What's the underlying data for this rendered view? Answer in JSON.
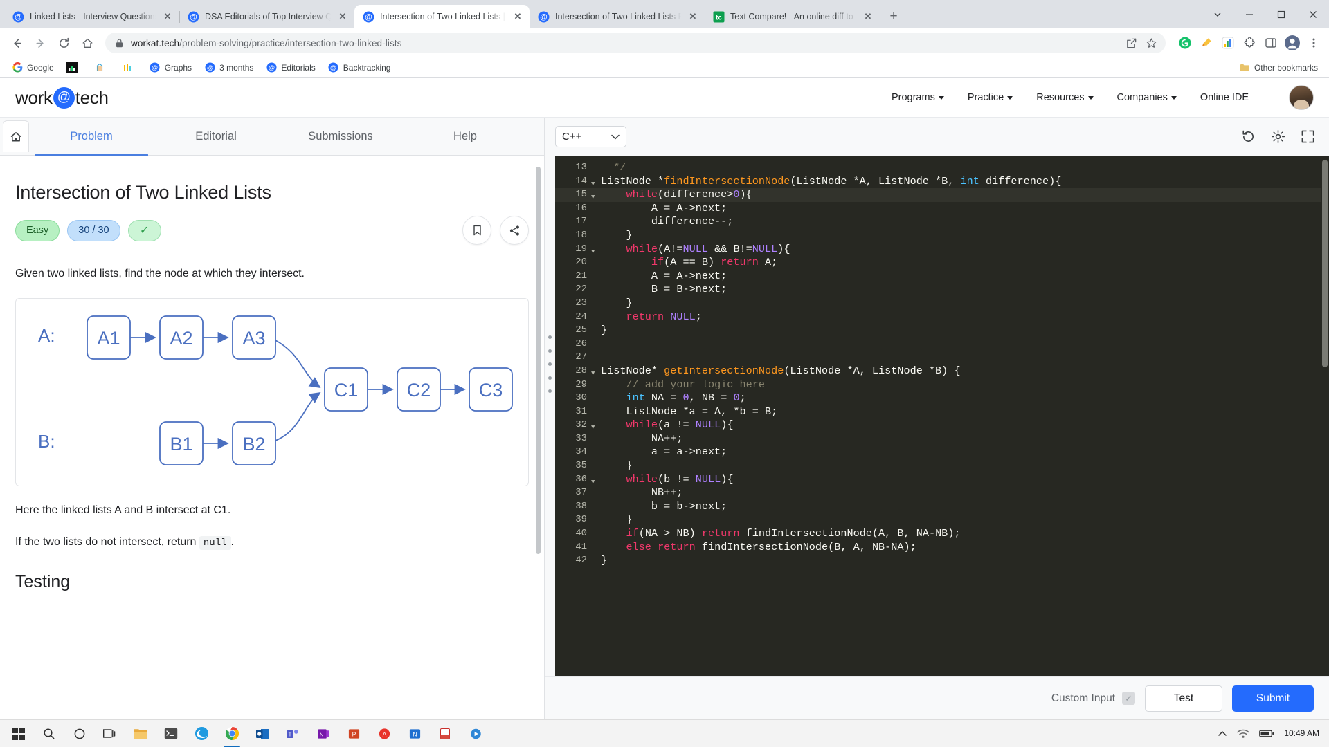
{
  "browser": {
    "tabs": [
      {
        "title": "Linked Lists - Interview Questions",
        "favicon": "workattech-icon",
        "active": false
      },
      {
        "title": "DSA Editorials of Top Interview Q",
        "favicon": "workattech-icon",
        "active": false
      },
      {
        "title": "Intersection of Two Linked Lists |",
        "favicon": "workattech-icon",
        "active": true
      },
      {
        "title": "Intersection of Two Linked Lists E",
        "favicon": "workattech-icon",
        "active": false
      },
      {
        "title": "Text Compare! - An online diff to",
        "favicon": "textcompare-icon",
        "active": false
      }
    ],
    "new_tab_label": "+",
    "url_bold": "workat.tech",
    "url_dim": "/problem-solving/practice/intersection-two-linked-lists",
    "window_controls": {
      "minimize": "–",
      "maximize": "❐",
      "close": "✕"
    },
    "bookmarks": [
      {
        "label": "Google",
        "icon": "google-icon"
      },
      {
        "label": "",
        "icon": "dark-chart-icon"
      },
      {
        "label": "",
        "icon": "ladder-icon"
      },
      {
        "label": "",
        "icon": "bars-icon"
      },
      {
        "label": "Graphs",
        "icon": "workattech-icon"
      },
      {
        "label": "3 months",
        "icon": "workattech-icon"
      },
      {
        "label": "Editorials",
        "icon": "workattech-icon"
      },
      {
        "label": "Backtracking",
        "icon": "workattech-icon"
      }
    ],
    "other_bookmarks": "Other bookmarks"
  },
  "site": {
    "logo_left": "work",
    "logo_at": "@",
    "logo_right": "tech",
    "nav": [
      {
        "label": "Programs",
        "has_caret": true
      },
      {
        "label": "Practice",
        "has_caret": true
      },
      {
        "label": "Resources",
        "has_caret": true
      },
      {
        "label": "Companies",
        "has_caret": true
      },
      {
        "label": "Online IDE",
        "has_caret": false
      }
    ]
  },
  "problem": {
    "tabs": [
      {
        "label": "Problem",
        "active": true
      },
      {
        "label": "Editorial",
        "active": false
      },
      {
        "label": "Submissions",
        "active": false
      },
      {
        "label": "Help",
        "active": false
      }
    ],
    "title": "Intersection of Two Linked Lists",
    "badges": {
      "difficulty": "Easy",
      "score": "30 / 30",
      "solved_check": "✓"
    },
    "description": "Given two linked lists, find the node at which they intersect.",
    "note": "Here the linked lists A and B intersect at C1.",
    "no_intersect_prefix": "If the two lists do not intersect, return",
    "no_intersect_code": "null",
    "no_intersect_suffix": ".",
    "testing_heading": "Testing",
    "figure": {
      "label_a": "A:",
      "label_b": "B:",
      "nodes_a": [
        "A1",
        "A2",
        "A3"
      ],
      "nodes_b": [
        "B1",
        "B2"
      ],
      "nodes_c": [
        "C1",
        "C2",
        "C3"
      ]
    }
  },
  "editor": {
    "language": "C++",
    "dropdown_caret": "⌄",
    "toolbar": {
      "reset": "reset-icon",
      "settings": "gear-icon",
      "fullscreen": "expand-icon"
    },
    "first_line_number": 13,
    "highlighted_line": 15,
    "lines": [
      {
        "n": 13,
        "fold": false,
        "tokens": [
          {
            "t": "  ",
            "c": "op"
          },
          {
            "t": "*/",
            "c": "cm"
          }
        ]
      },
      {
        "n": 14,
        "fold": true,
        "tokens": [
          {
            "t": "ListNode *",
            "c": "op"
          },
          {
            "t": "findIntersectionNode",
            "c": "fn"
          },
          {
            "t": "(ListNode *A, ListNode *B, ",
            "c": "op"
          },
          {
            "t": "int",
            "c": "ty"
          },
          {
            "t": " difference){",
            "c": "op"
          }
        ]
      },
      {
        "n": 15,
        "fold": true,
        "tokens": [
          {
            "t": "    ",
            "c": "op"
          },
          {
            "t": "while",
            "c": "k"
          },
          {
            "t": "(difference>",
            "c": "op"
          },
          {
            "t": "0",
            "c": "nl"
          },
          {
            "t": "){",
            "c": "op"
          }
        ]
      },
      {
        "n": 16,
        "fold": false,
        "tokens": [
          {
            "t": "        A = A->next;",
            "c": "op"
          }
        ]
      },
      {
        "n": 17,
        "fold": false,
        "tokens": [
          {
            "t": "        difference--;",
            "c": "op"
          }
        ]
      },
      {
        "n": 18,
        "fold": false,
        "tokens": [
          {
            "t": "    }",
            "c": "op"
          }
        ]
      },
      {
        "n": 19,
        "fold": true,
        "tokens": [
          {
            "t": "    ",
            "c": "op"
          },
          {
            "t": "while",
            "c": "k"
          },
          {
            "t": "(A!=",
            "c": "op"
          },
          {
            "t": "NULL",
            "c": "nl"
          },
          {
            "t": " && B!=",
            "c": "op"
          },
          {
            "t": "NULL",
            "c": "nl"
          },
          {
            "t": "){",
            "c": "op"
          }
        ]
      },
      {
        "n": 20,
        "fold": false,
        "tokens": [
          {
            "t": "        ",
            "c": "op"
          },
          {
            "t": "if",
            "c": "k"
          },
          {
            "t": "(A == B) ",
            "c": "op"
          },
          {
            "t": "return",
            "c": "k"
          },
          {
            "t": " A;",
            "c": "op"
          }
        ]
      },
      {
        "n": 21,
        "fold": false,
        "tokens": [
          {
            "t": "        A = A->next;",
            "c": "op"
          }
        ]
      },
      {
        "n": 22,
        "fold": false,
        "tokens": [
          {
            "t": "        B = B->next;",
            "c": "op"
          }
        ]
      },
      {
        "n": 23,
        "fold": false,
        "tokens": [
          {
            "t": "    }",
            "c": "op"
          }
        ]
      },
      {
        "n": 24,
        "fold": false,
        "tokens": [
          {
            "t": "    ",
            "c": "op"
          },
          {
            "t": "return",
            "c": "k"
          },
          {
            "t": " ",
            "c": "op"
          },
          {
            "t": "NULL",
            "c": "nl"
          },
          {
            "t": ";",
            "c": "op"
          }
        ]
      },
      {
        "n": 25,
        "fold": false,
        "tokens": [
          {
            "t": "}",
            "c": "op"
          }
        ]
      },
      {
        "n": 26,
        "fold": false,
        "tokens": [
          {
            "t": "",
            "c": "op"
          }
        ]
      },
      {
        "n": 27,
        "fold": false,
        "tokens": [
          {
            "t": "",
            "c": "op"
          }
        ]
      },
      {
        "n": 28,
        "fold": true,
        "tokens": [
          {
            "t": "ListNode* ",
            "c": "op"
          },
          {
            "t": "getIntersectionNode",
            "c": "fn"
          },
          {
            "t": "(ListNode *A, ListNode *B) {",
            "c": "op"
          }
        ]
      },
      {
        "n": 29,
        "fold": false,
        "tokens": [
          {
            "t": "    ",
            "c": "op"
          },
          {
            "t": "// add your logic here",
            "c": "cm"
          }
        ]
      },
      {
        "n": 30,
        "fold": false,
        "tokens": [
          {
            "t": "    ",
            "c": "op"
          },
          {
            "t": "int",
            "c": "ty"
          },
          {
            "t": " NA = ",
            "c": "op"
          },
          {
            "t": "0",
            "c": "nl"
          },
          {
            "t": ", NB = ",
            "c": "op"
          },
          {
            "t": "0",
            "c": "nl"
          },
          {
            "t": ";",
            "c": "op"
          }
        ]
      },
      {
        "n": 31,
        "fold": false,
        "tokens": [
          {
            "t": "    ListNode *a = A, *b = B;",
            "c": "op"
          }
        ]
      },
      {
        "n": 32,
        "fold": true,
        "tokens": [
          {
            "t": "    ",
            "c": "op"
          },
          {
            "t": "while",
            "c": "k"
          },
          {
            "t": "(a != ",
            "c": "op"
          },
          {
            "t": "NULL",
            "c": "nl"
          },
          {
            "t": "){",
            "c": "op"
          }
        ]
      },
      {
        "n": 33,
        "fold": false,
        "tokens": [
          {
            "t": "        NA++;",
            "c": "op"
          }
        ]
      },
      {
        "n": 34,
        "fold": false,
        "tokens": [
          {
            "t": "        a = a->next;",
            "c": "op"
          }
        ]
      },
      {
        "n": 35,
        "fold": false,
        "tokens": [
          {
            "t": "    }",
            "c": "op"
          }
        ]
      },
      {
        "n": 36,
        "fold": true,
        "tokens": [
          {
            "t": "    ",
            "c": "op"
          },
          {
            "t": "while",
            "c": "k"
          },
          {
            "t": "(b != ",
            "c": "op"
          },
          {
            "t": "NULL",
            "c": "nl"
          },
          {
            "t": "){",
            "c": "op"
          }
        ]
      },
      {
        "n": 37,
        "fold": false,
        "tokens": [
          {
            "t": "        NB++;",
            "c": "op"
          }
        ]
      },
      {
        "n": 38,
        "fold": false,
        "tokens": [
          {
            "t": "        b = b->next;",
            "c": "op"
          }
        ]
      },
      {
        "n": 39,
        "fold": false,
        "tokens": [
          {
            "t": "    }",
            "c": "op"
          }
        ]
      },
      {
        "n": 40,
        "fold": false,
        "tokens": [
          {
            "t": "    ",
            "c": "op"
          },
          {
            "t": "if",
            "c": "k"
          },
          {
            "t": "(NA > NB) ",
            "c": "op"
          },
          {
            "t": "return",
            "c": "k"
          },
          {
            "t": " findIntersectionNode(A, B, NA-NB);",
            "c": "op"
          }
        ]
      },
      {
        "n": 41,
        "fold": false,
        "tokens": [
          {
            "t": "    ",
            "c": "op"
          },
          {
            "t": "else",
            "c": "k"
          },
          {
            "t": " ",
            "c": "op"
          },
          {
            "t": "return",
            "c": "k"
          },
          {
            "t": " findIntersectionNode(B, A, NB-NA);",
            "c": "op"
          }
        ]
      },
      {
        "n": 42,
        "fold": false,
        "tokens": [
          {
            "t": "}",
            "c": "op"
          }
        ]
      }
    ],
    "bottom": {
      "custom_input_label": "Custom Input",
      "test_label": "Test",
      "submit_label": "Submit"
    }
  },
  "taskbar": {
    "clock_time": "10:49 AM",
    "apps": [
      "start-icon",
      "search-icon",
      "cortana-icon",
      "taskview-icon",
      "explorer-icon",
      "terminal-icon",
      "edge-icon",
      "chrome-icon",
      "outlook-icon",
      "teams-icon",
      "onenote-icon",
      "powerpoint-icon",
      "acrobat-icon",
      "notion-icon",
      "pdf-icon",
      "media-icon"
    ],
    "tray": [
      "chevron-up-icon",
      "network-icon",
      "battery-icon"
    ]
  },
  "colors": {
    "accent": "#246bfd",
    "tab_active": "#4a7fe0",
    "easy_badge": "#b7f0c2",
    "score_badge": "#c2dffb",
    "editor_bg": "#272822",
    "keyword": "#f0386b",
    "function": "#fd971f",
    "null_literal": "#ae81ff",
    "comment": "#88846f",
    "type": "#4bc3ff"
  }
}
